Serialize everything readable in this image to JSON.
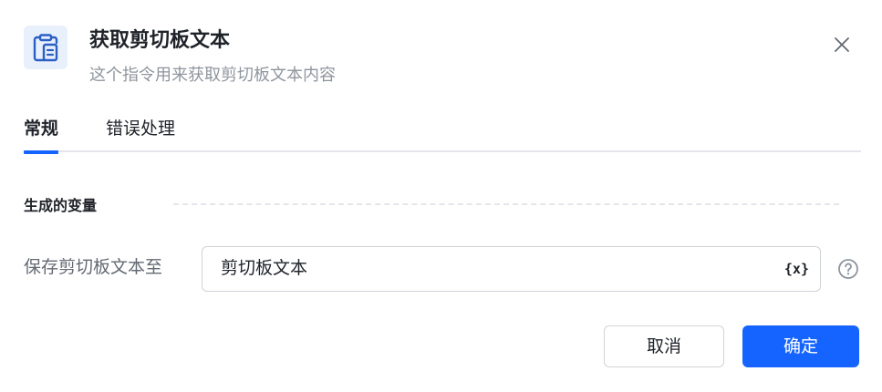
{
  "header": {
    "icon": "clipboard-text-icon",
    "title": "获取剪切板文本",
    "subtitle": "这个指令用来获取剪切板文本内容",
    "close_icon": "close-icon"
  },
  "tabs": [
    {
      "label": "常规",
      "active": true
    },
    {
      "label": "错误处理",
      "active": false
    }
  ],
  "section": {
    "title": "生成的变量"
  },
  "field": {
    "label": "保存剪切板文本至",
    "value": "剪切板文本",
    "variable_icon_text": "{x}",
    "help_icon": "question-circle-icon"
  },
  "footer": {
    "cancel_label": "取消",
    "confirm_label": "确定"
  },
  "colors": {
    "accent": "#1664ff",
    "icon_bg": "#e8f0fc",
    "muted_text": "#8f959e",
    "label_text": "#646a73",
    "border": "#d0d3d6"
  }
}
